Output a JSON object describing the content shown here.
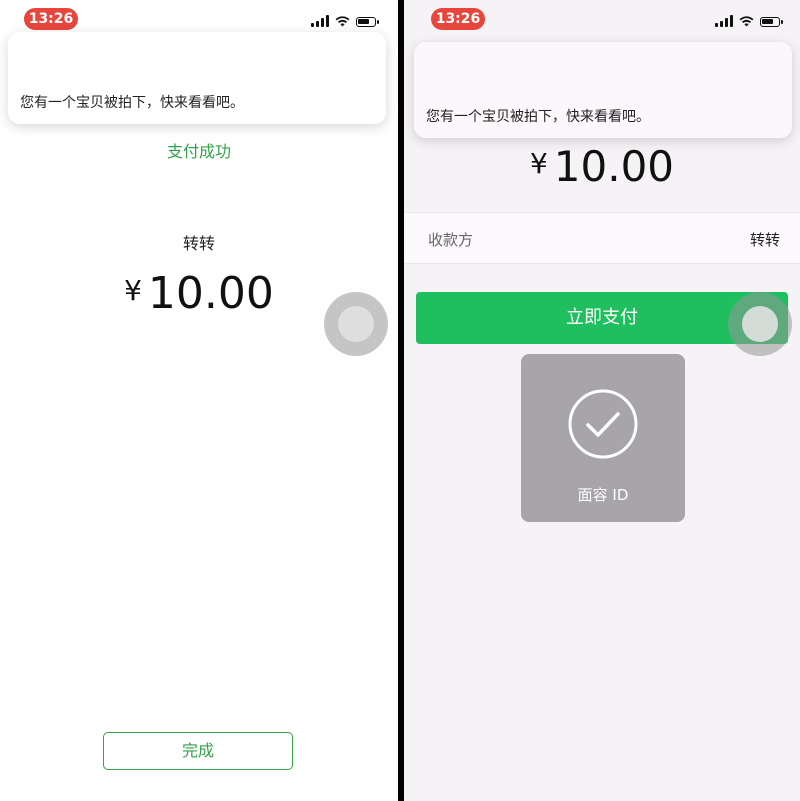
{
  "left": {
    "status": {
      "time": "13:26"
    },
    "notification": {
      "text": "您有一个宝贝被拍下，快来看看吧。"
    },
    "payment": {
      "success_text": "支付成功",
      "payee": "转转",
      "currency": "¥",
      "amount": "10.00"
    },
    "done_button": "完成"
  },
  "right": {
    "status": {
      "time": "13:26"
    },
    "notification": {
      "text": "您有一个宝贝被拍下，快来看看吧。"
    },
    "payment": {
      "currency": "¥",
      "amount": "10.00",
      "payee_label": "收款方",
      "payee_value": "转转"
    },
    "pay_button": "立即支付",
    "faceid": {
      "label": "面容 ID"
    }
  },
  "colors": {
    "success_green": "#33a24a",
    "pay_button_green": "#1fbf5f",
    "time_pill_red": "#e8453c"
  },
  "icons": [
    "signal-icon",
    "wifi-icon",
    "battery-icon",
    "assistive-touch-icon",
    "checkmark-icon"
  ]
}
